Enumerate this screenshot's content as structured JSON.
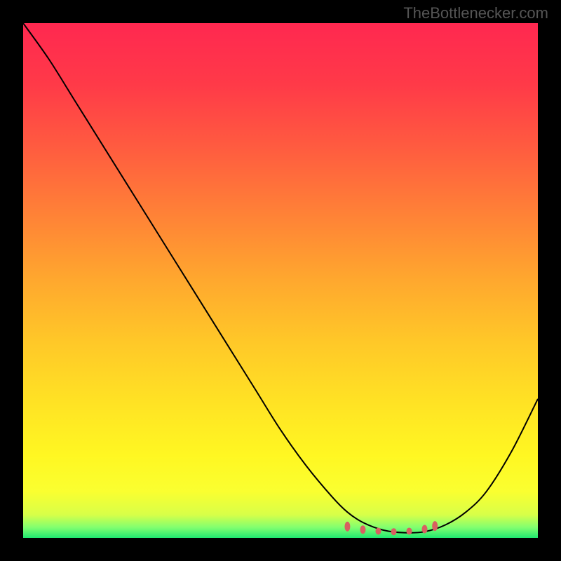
{
  "attribution": "TheBottlenecker.com",
  "chart_data": {
    "type": "line",
    "title": "",
    "xlabel": "",
    "ylabel": "",
    "xlim": [
      0,
      100
    ],
    "ylim": [
      0,
      100
    ],
    "series": [
      {
        "name": "curve",
        "x": [
          0,
          5,
          10,
          15,
          20,
          25,
          30,
          35,
          40,
          45,
          50,
          55,
          60,
          63,
          66,
          70,
          74,
          78,
          82,
          86,
          90,
          95,
          100
        ],
        "y": [
          100,
          93,
          85,
          77,
          69,
          61,
          53,
          45,
          37,
          29,
          21,
          14,
          8,
          5,
          3,
          1.5,
          1,
          1.2,
          2.5,
          5,
          9,
          17,
          27
        ]
      }
    ],
    "markers": {
      "x": [
        63,
        66,
        69,
        72,
        75,
        78,
        80
      ],
      "y": [
        2.2,
        1.6,
        1.3,
        1.2,
        1.3,
        1.7,
        2.3
      ],
      "widths": [
        8,
        8,
        8,
        8,
        8,
        8,
        8
      ],
      "heights": [
        14,
        12,
        10,
        10,
        10,
        12,
        14
      ]
    },
    "gradient": {
      "stops": [
        {
          "offset": 0,
          "color": "#ff2850"
        },
        {
          "offset": 0.12,
          "color": "#ff3a48"
        },
        {
          "offset": 0.25,
          "color": "#ff5e3f"
        },
        {
          "offset": 0.38,
          "color": "#ff8436"
        },
        {
          "offset": 0.5,
          "color": "#ffa82e"
        },
        {
          "offset": 0.62,
          "color": "#ffc828"
        },
        {
          "offset": 0.74,
          "color": "#ffe324"
        },
        {
          "offset": 0.84,
          "color": "#fff722"
        },
        {
          "offset": 0.91,
          "color": "#faff30"
        },
        {
          "offset": 0.955,
          "color": "#d8ff48"
        },
        {
          "offset": 0.98,
          "color": "#80ff70"
        },
        {
          "offset": 1.0,
          "color": "#20e870"
        }
      ]
    },
    "marker_color": "#d86060"
  }
}
